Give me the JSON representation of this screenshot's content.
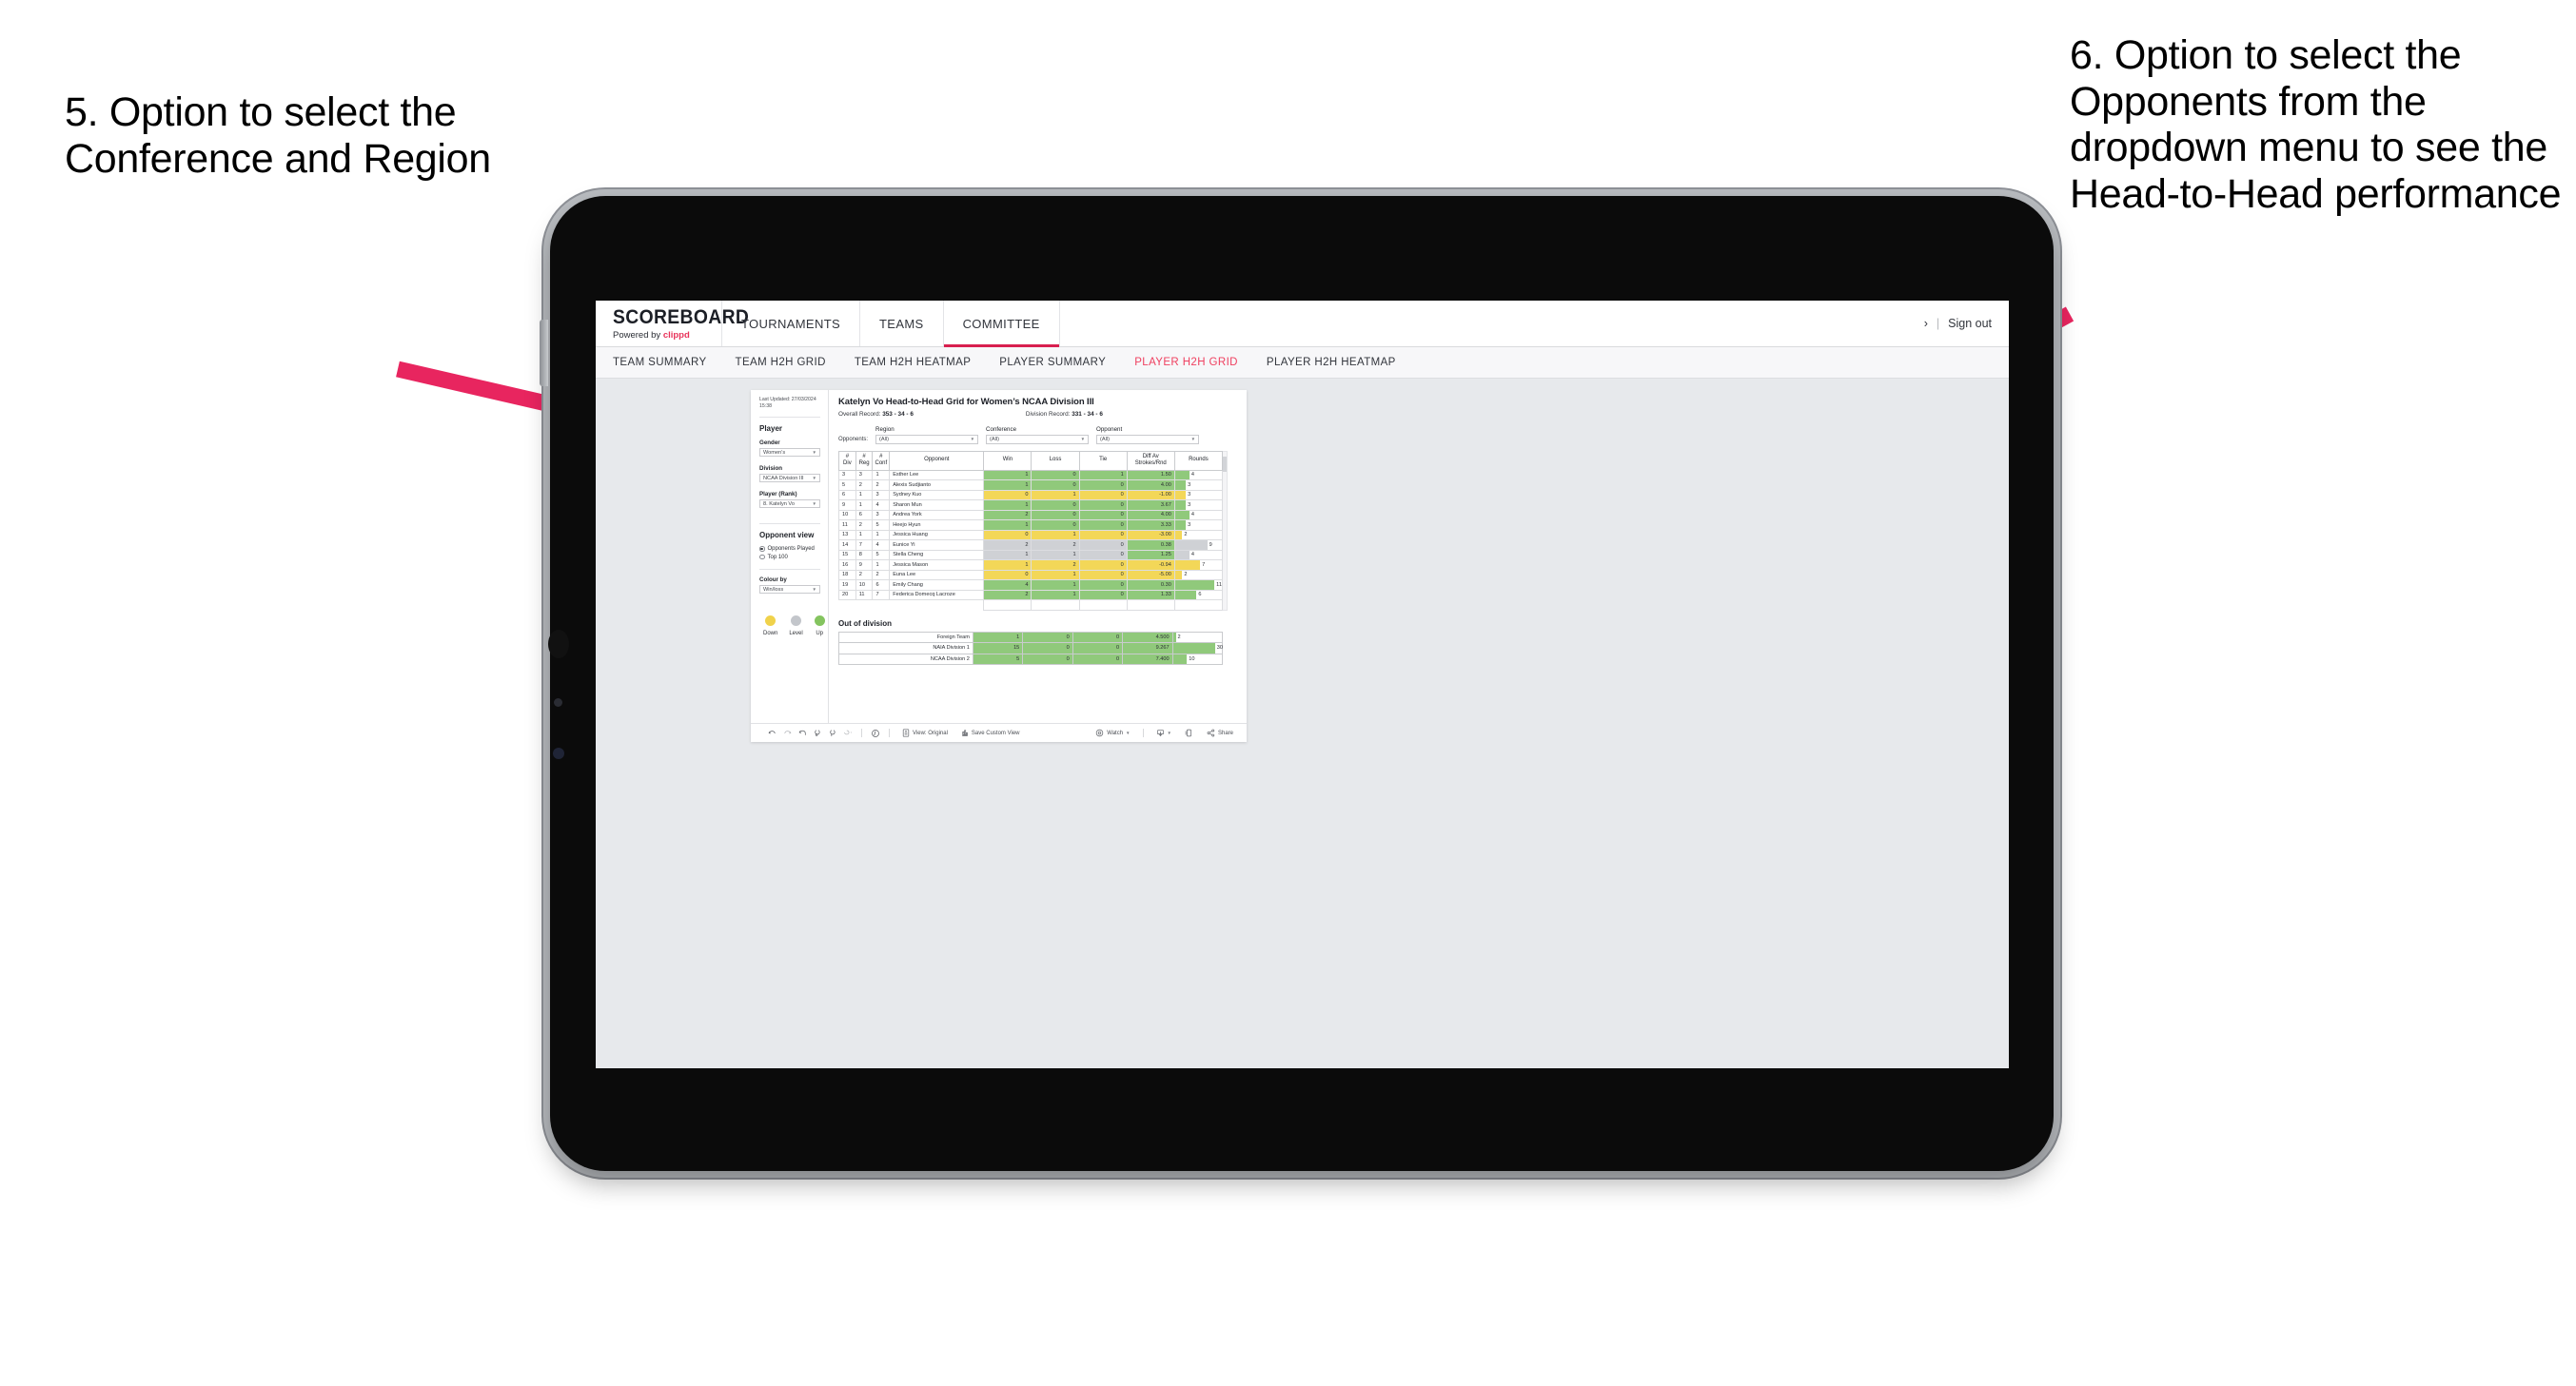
{
  "annotations": {
    "left": "5. Option to select the Conference and Region",
    "right": "6. Option to select the Opponents from the dropdown menu to see the Head-to-Head performance",
    "arrow_color": "#E8255F"
  },
  "app": {
    "logo": {
      "word": "SCOREBOARD",
      "powered_prefix": "Powered by ",
      "brand": "clippd"
    },
    "topnav": [
      {
        "label": "TOURNAMENTS",
        "active": false
      },
      {
        "label": "TEAMS",
        "active": false
      },
      {
        "label": "COMMITTEE",
        "active": true
      }
    ],
    "account": {
      "user_glyph": "›",
      "separator": "|",
      "sign_out": "Sign out"
    },
    "subnav": [
      {
        "label": "TEAM SUMMARY",
        "active": false
      },
      {
        "label": "TEAM H2H GRID",
        "active": false
      },
      {
        "label": "TEAM H2H HEATMAP",
        "active": false
      },
      {
        "label": "PLAYER SUMMARY",
        "active": false
      },
      {
        "label": "PLAYER H2H GRID",
        "active": true
      },
      {
        "label": "PLAYER H2H HEATMAP",
        "active": false
      }
    ]
  },
  "panel": {
    "last_updated": "Last Updated: 27/03/2024 15:38",
    "heading": "Player",
    "fields": [
      {
        "label": "Gender",
        "value": "Women’s"
      },
      {
        "label": "Division",
        "value": "NCAA Division III"
      },
      {
        "label": "Player (Rank)",
        "value": "8. Katelyn Vo"
      }
    ],
    "opponent_view": {
      "heading": "Opponent view",
      "options": [
        {
          "label": "Opponents Played",
          "selected": true
        },
        {
          "label": "Top 100",
          "selected": false
        }
      ]
    },
    "colour_by": {
      "label": "Colour by",
      "value": "Win/loss"
    },
    "legend": [
      {
        "label": "Down",
        "color": "#F0D24B"
      },
      {
        "label": "Level",
        "color": "#C3C6CB"
      },
      {
        "label": "Up",
        "color": "#84C45F"
      }
    ]
  },
  "viz": {
    "title": "Katelyn Vo Head-to-Head Grid for Women’s NCAA Division III",
    "overall_record_label": "Overall Record:",
    "overall_record": "353 - 34 - 6",
    "division_record_label": "Division Record:",
    "division_record": "331 -  34 - 6",
    "filters": {
      "prefix": "Opponents:",
      "items": [
        {
          "label": "Region",
          "value": "(All)"
        },
        {
          "label": "Conference",
          "value": "(All)"
        },
        {
          "label": "Opponent",
          "value": "(All)"
        }
      ]
    },
    "out_of_division_title": "Out of division"
  },
  "chart_data": {
    "type": "table",
    "title": "Katelyn Vo Head-to-Head Grid for Women’s NCAA Division III",
    "columns": [
      "# Div",
      "# Reg",
      "# Conf",
      "Opponent",
      "Win",
      "Loss",
      "Tie",
      "Diff Av Strokes/Rnd",
      "Rounds"
    ],
    "column_headers_two_line": [
      {
        "top": "#",
        "bottom": "Div"
      },
      {
        "top": "#",
        "bottom": "Reg"
      },
      {
        "top": "#",
        "bottom": "Conf"
      },
      {
        "top": "Opponent",
        "bottom": ""
      },
      {
        "top": "Win",
        "bottom": ""
      },
      {
        "top": "Loss",
        "bottom": ""
      },
      {
        "top": "Tie",
        "bottom": ""
      },
      {
        "top": "Diff Av",
        "bottom": "Strokes/Rnd"
      },
      {
        "top": "Rounds",
        "bottom": ""
      }
    ],
    "rounds_max": 11,
    "colors": {
      "up": "#90C97B",
      "down": "#F3D758",
      "level": "#CFD1D5"
    },
    "rows": [
      {
        "div": "3",
        "reg": "3",
        "conf": "1",
        "opponent": "Esther Lee",
        "win": "1",
        "loss": "0",
        "tie": "1",
        "diff": "1.50",
        "rounds": 4,
        "state": "up"
      },
      {
        "div": "5",
        "reg": "2",
        "conf": "2",
        "opponent": "Alexis Sudjianto",
        "win": "1",
        "loss": "0",
        "tie": "0",
        "diff": "4.00",
        "rounds": 3,
        "state": "up"
      },
      {
        "div": "6",
        "reg": "1",
        "conf": "3",
        "opponent": "Sydney Kuo",
        "win": "0",
        "loss": "1",
        "tie": "0",
        "diff": "-1.00",
        "rounds": 3,
        "state": "down"
      },
      {
        "div": "9",
        "reg": "1",
        "conf": "4",
        "opponent": "Sharon Mun",
        "win": "1",
        "loss": "0",
        "tie": "0",
        "diff": "3.67",
        "rounds": 3,
        "state": "up"
      },
      {
        "div": "10",
        "reg": "6",
        "conf": "3",
        "opponent": "Andrea York",
        "win": "2",
        "loss": "0",
        "tie": "0",
        "diff": "4.00",
        "rounds": 4,
        "state": "up"
      },
      {
        "div": "11",
        "reg": "2",
        "conf": "5",
        "opponent": "Heejo Hyun",
        "win": "1",
        "loss": "0",
        "tie": "0",
        "diff": "3.33",
        "rounds": 3,
        "state": "up"
      },
      {
        "div": "13",
        "reg": "1",
        "conf": "1",
        "opponent": "Jessica Huang",
        "win": "0",
        "loss": "1",
        "tie": "0",
        "diff": "-3.00",
        "rounds": 2,
        "state": "down"
      },
      {
        "div": "14",
        "reg": "7",
        "conf": "4",
        "opponent": "Eunice Yi",
        "win": "2",
        "loss": "2",
        "tie": "0",
        "diff": "0.38",
        "rounds": 9,
        "state": "level",
        "diff_state": "up"
      },
      {
        "div": "15",
        "reg": "8",
        "conf": "5",
        "opponent": "Stella Cheng",
        "win": "1",
        "loss": "1",
        "tie": "0",
        "diff": "1.25",
        "rounds": 4,
        "state": "level",
        "diff_state": "up"
      },
      {
        "div": "16",
        "reg": "9",
        "conf": "1",
        "opponent": "Jessica Mason",
        "win": "1",
        "loss": "2",
        "tie": "0",
        "diff": "-0.94",
        "rounds": 7,
        "state": "down"
      },
      {
        "div": "18",
        "reg": "2",
        "conf": "2",
        "opponent": "Euna Lee",
        "win": "0",
        "loss": "1",
        "tie": "0",
        "diff": "-5.00",
        "rounds": 2,
        "state": "down"
      },
      {
        "div": "19",
        "reg": "10",
        "conf": "6",
        "opponent": "Emily Chang",
        "win": "4",
        "loss": "1",
        "tie": "0",
        "diff": "0.30",
        "rounds": 11,
        "state": "up"
      },
      {
        "div": "20",
        "reg": "11",
        "conf": "7",
        "opponent": "Federica Domecq Lacroze",
        "win": "2",
        "loss": "1",
        "tie": "0",
        "diff": "1.33",
        "rounds": 6,
        "state": "up"
      }
    ],
    "out_of_division": {
      "title": "Out of division",
      "rounds_max": 30,
      "rows": [
        {
          "name": "Foreign Team",
          "win": "1",
          "loss": "0",
          "tie": "0",
          "diff": "4.500",
          "rounds": 2,
          "state": "up"
        },
        {
          "name": "NAIA Division 1",
          "win": "15",
          "loss": "0",
          "tie": "0",
          "diff": "9.267",
          "rounds": 30,
          "state": "up"
        },
        {
          "name": "NCAA Division 2",
          "win": "5",
          "loss": "0",
          "tie": "0",
          "diff": "7.400",
          "rounds": 10,
          "state": "up"
        }
      ]
    }
  },
  "toolbar": {
    "icons": [
      "undo-icon",
      "redo-icon",
      "revert-icon",
      "refresh-icon",
      "pause-icon",
      "alerts-icon"
    ],
    "view_label": "View: Original",
    "save_custom_view": "Save Custom View",
    "watch": "Watch",
    "share": "Share"
  }
}
